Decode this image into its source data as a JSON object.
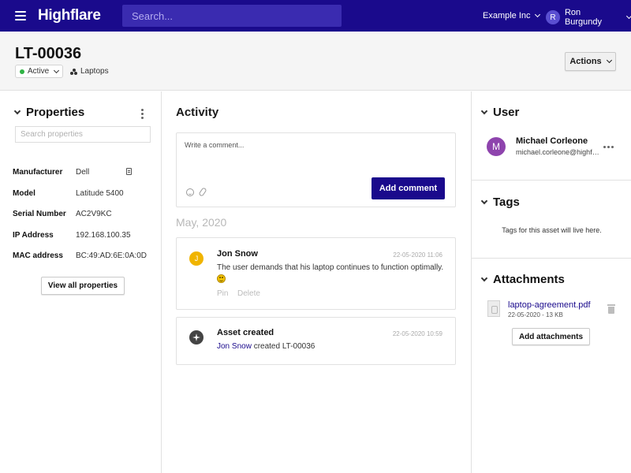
{
  "app": {
    "brand": "Highflare",
    "search_placeholder": "Search...",
    "org": "Example Inc",
    "user_initial": "R",
    "user_name": "Ron Burgundy",
    "primary_color": "#1a0a8c"
  },
  "asset": {
    "id": "LT-00036",
    "status": "Active",
    "status_color": "#2fb344",
    "category": "Laptops",
    "actions_label": "Actions"
  },
  "properties": {
    "title": "Properties",
    "search_placeholder": "Search properties",
    "items": [
      {
        "key": "Manufacturer",
        "value": "Dell"
      },
      {
        "key": "Model",
        "value": "Latitude 5400"
      },
      {
        "key": "Serial Number",
        "value": "AC2V9KC"
      },
      {
        "key": "IP Address",
        "value": "192.168.100.35"
      },
      {
        "key": "MAC address",
        "value": "BC:49:AD:6E:0A:0D"
      }
    ],
    "view_all_label": "View all properties"
  },
  "activity": {
    "title": "Activity",
    "comment_placeholder": "Write a comment...",
    "add_comment_label": "Add comment",
    "date_group": "May, 2020",
    "entries": [
      {
        "author_initial": "J",
        "author": "Jon Snow",
        "timestamp": "22-05-2020 11:06",
        "text": "The user demands that his laptop continues to function optimally.",
        "pin_label": "Pin",
        "delete_label": "Delete"
      },
      {
        "title": "Asset created",
        "timestamp": "22-05-2020 10:59",
        "actor": "Jon Snow",
        "text": "created LT-00036"
      }
    ]
  },
  "user_panel": {
    "title": "User",
    "initial": "M",
    "name": "Michael Corleone",
    "email": "michael.corleone@highflare.com"
  },
  "tags_panel": {
    "title": "Tags",
    "hint": "Tags for this asset will live here."
  },
  "attachments_panel": {
    "title": "Attachments",
    "file_name": "laptop-agreement.pdf",
    "file_meta": "22-05-2020 - 13 KB",
    "add_label": "Add attachments"
  }
}
